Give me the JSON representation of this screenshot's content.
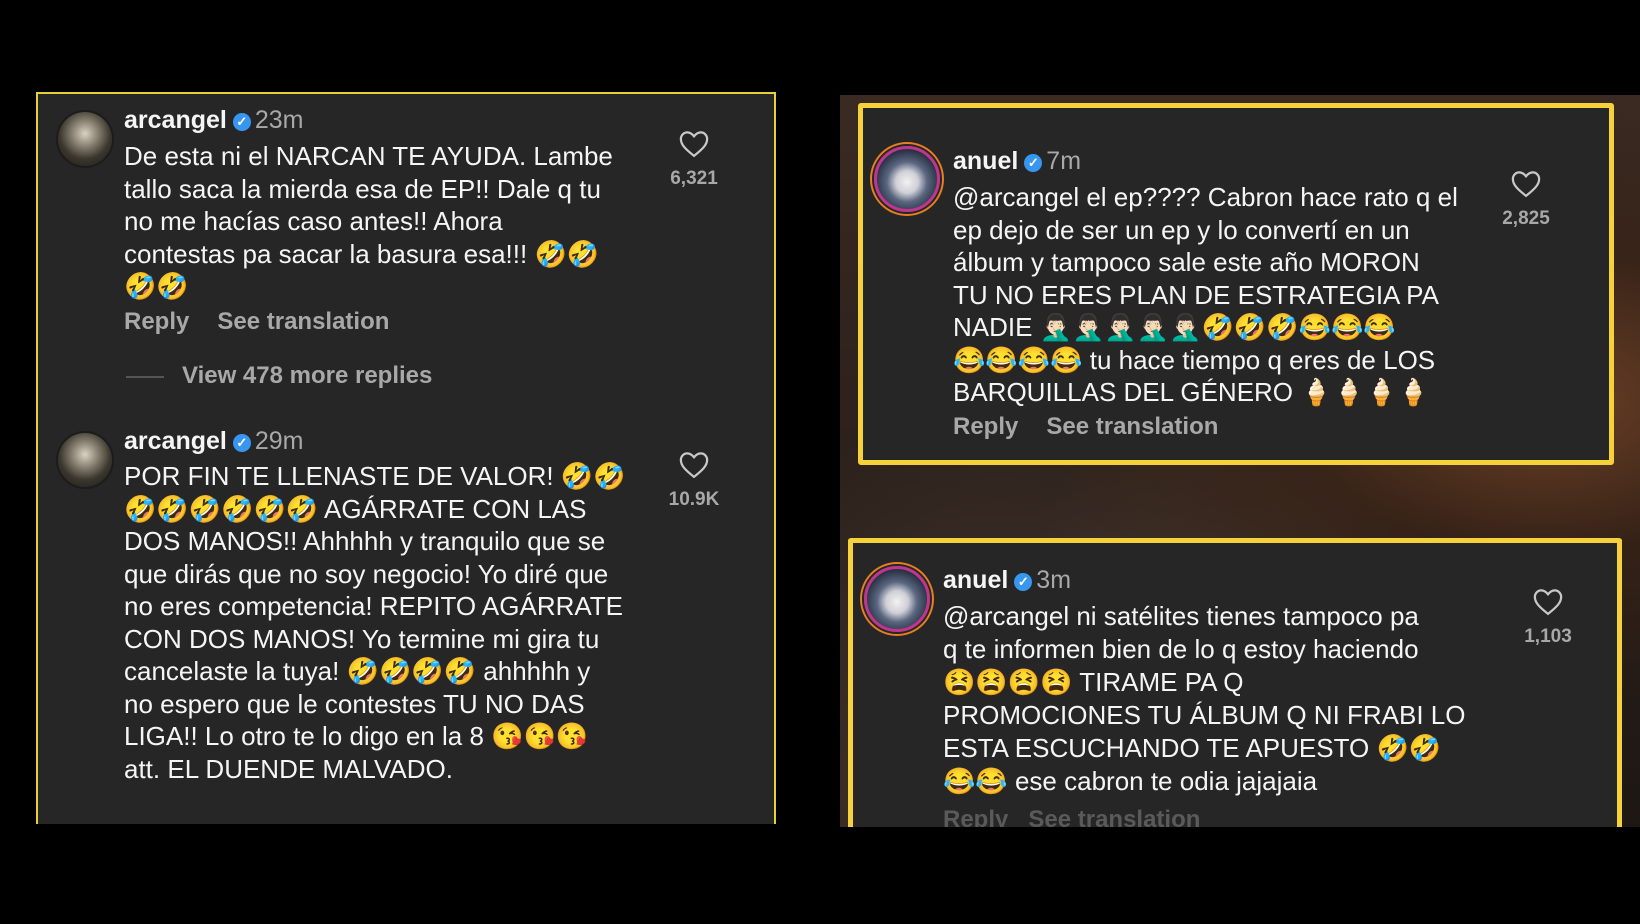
{
  "left": {
    "comments": [
      {
        "username": "arcangel",
        "time": "23m",
        "text": "De esta ni el NARCAN TE AYUDA. Lambe\ntallo saca la mierda esa de EP!! Dale q tu\nno me hacías caso antes!! Ahora\ncontestas pa sacar la basura esa!!! 🤣🤣\n🤣🤣",
        "likes": "6,321",
        "reply": "Reply",
        "see_translation": "See translation"
      },
      {
        "username": "arcangel",
        "time": "29m",
        "text": "POR FIN TE LLENASTE DE VALOR! 🤣🤣\n🤣🤣🤣🤣🤣🤣 AGÁRRATE CON LAS\nDOS MANOS!! Ahhhhh y tranquilo que se\nque dirás que no soy negocio! Yo diré que\nno eres competencia! REPITO AGÁRRATE\nCON DOS MANOS! Yo termine mi gira tu\ncancelaste la tuya! 🤣🤣🤣🤣 ahhhhh y\nno espero que le contestes TU NO DAS\nLIGA!! Lo otro te lo digo en la 8 😘😘😘\natt. EL DUENDE MALVADO.",
        "likes": "10.9K"
      }
    ],
    "view_replies": "View 478 more replies"
  },
  "right": {
    "comments": [
      {
        "username": "anuel",
        "time": "7m",
        "text": "@arcangel el ep???? Cabron hace rato q el\nep dejo de ser un ep y lo convertí en un\nálbum y tampoco sale este año MORON\nTU NO ERES PLAN DE ESTRATEGIA PA\nNADIE 🤦🏻‍♂️🤦🏻‍♂️🤦🏻‍♂️🤦🏻‍♂️🤦🏻‍♂️🤣🤣🤣😂😂😂\n😂😂😂😂 tu hace tiempo q eres de LOS\nBARQUILLAS DEL GÉNERO 🍦🍦🍦🍦",
        "likes": "2,825",
        "reply": "Reply",
        "see_translation": "See translation"
      },
      {
        "username": "anuel",
        "time": "3m",
        "text": "@arcangel ni satélites tienes tampoco pa\nq te informen bien de lo q estoy haciendo\n😫😫😫😫 TIRAME PA Q\nPROMOCIONES TU ÁLBUM Q NI FRABI LO\nESTA ESCUCHANDO TE APUESTO 🤣🤣\n😂😂 ese cabron te odia jajajaia",
        "likes": "1,103",
        "cut_actions": "Reply   See translation"
      }
    ]
  },
  "colors": {
    "highlight_border": "#f5d23a",
    "verified_badge": "#3797f0",
    "comment_bg": "#262626"
  }
}
